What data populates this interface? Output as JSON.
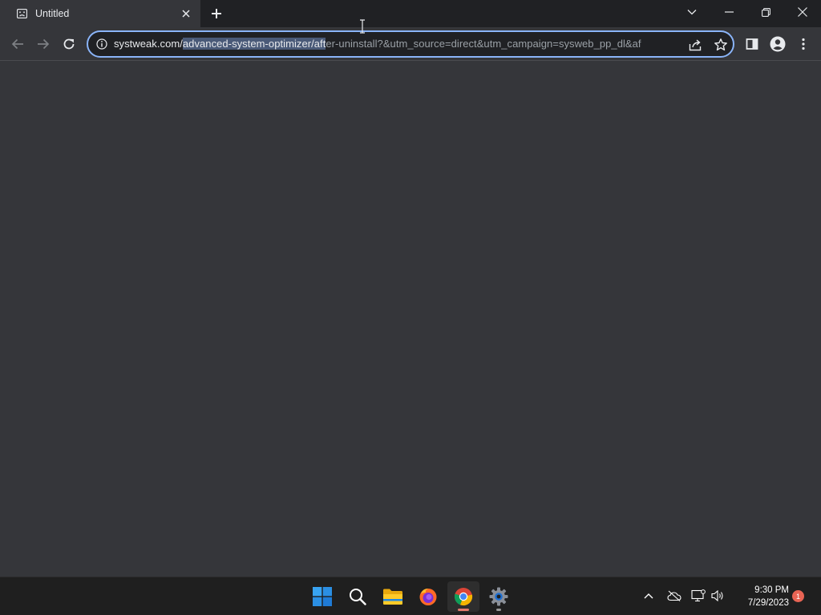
{
  "browser": {
    "tab": {
      "title": "Untitled"
    },
    "address_bar": {
      "url_host": "systweak.com/",
      "url_selected": "advanced-system-optimizer/aft",
      "url_rest": "er-uninstall?&utm_source=direct&utm_campaign=sysweb_pp_dl&af"
    }
  },
  "taskbar": {
    "apps": [
      {
        "name": "start-button",
        "icon": "windows-logo"
      },
      {
        "name": "search-button",
        "icon": "search-icon"
      },
      {
        "name": "file-explorer",
        "icon": "folder-icon"
      },
      {
        "name": "firefox",
        "icon": "firefox-icon"
      },
      {
        "name": "chrome",
        "icon": "chrome-icon",
        "active": true
      },
      {
        "name": "settings",
        "icon": "gear-icon"
      }
    ],
    "clock": {
      "time": "9:30 PM",
      "date": "7/29/2023"
    },
    "notification_count": "1"
  },
  "colors": {
    "tabstrip": "#202124",
    "toolbar": "#35363a",
    "omnibox_border": "#8ab4f8",
    "taskbar": "#1f1f1f"
  }
}
